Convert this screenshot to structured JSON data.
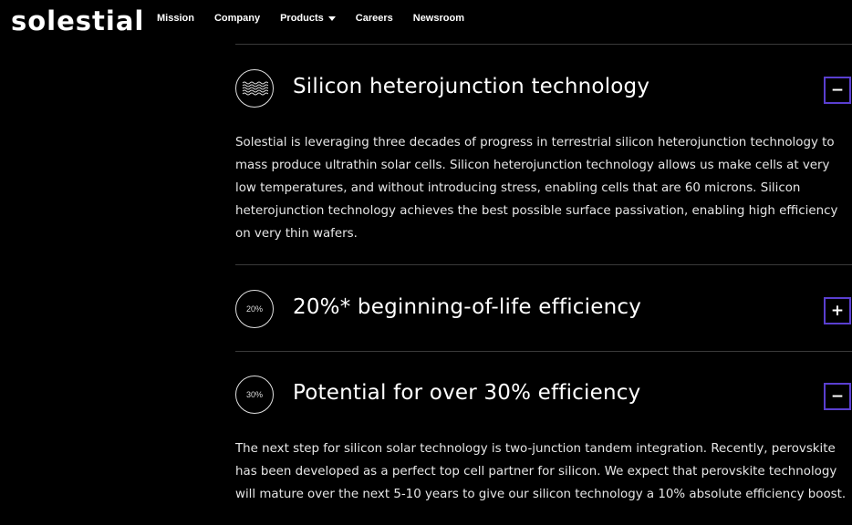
{
  "nav": {
    "logo": "solestial",
    "links": [
      "Mission",
      "Company",
      "Products",
      "Careers",
      "Newsroom"
    ]
  },
  "items": [
    {
      "badge": "",
      "icon": "wavy-lines-icon",
      "title": "Silicon heterojunction technology",
      "toggle": "−",
      "body": "Solestial is leveraging three decades of progress in terrestrial silicon heterojunction technology to mass produce ultrathin solar cells. Silicon heterojunction technology allows us make cells at very low temperatures, and without introducing stress, enabling cells that are 60 microns. Silicon heterojunction technology achieves the best possible surface passivation, enabling high efficiency on very thin wafers."
    },
    {
      "badge": "20%",
      "title": "20%* beginning-of-life efficiency",
      "toggle": "+"
    },
    {
      "badge": "30%",
      "title": "Potential for over 30% efficiency",
      "toggle": "−",
      "body": "The next step for silicon solar technology is two-junction tandem integration. Recently, perovskite has been developed as a perfect top cell partner for silicon. We expect that perovskite technology will mature over the next 5-10 years to give our silicon technology a 10% absolute efficiency boost."
    }
  ],
  "colors": {
    "background": "#000000",
    "accent": "#5a3fd0",
    "divider": "#3a3a3a"
  }
}
